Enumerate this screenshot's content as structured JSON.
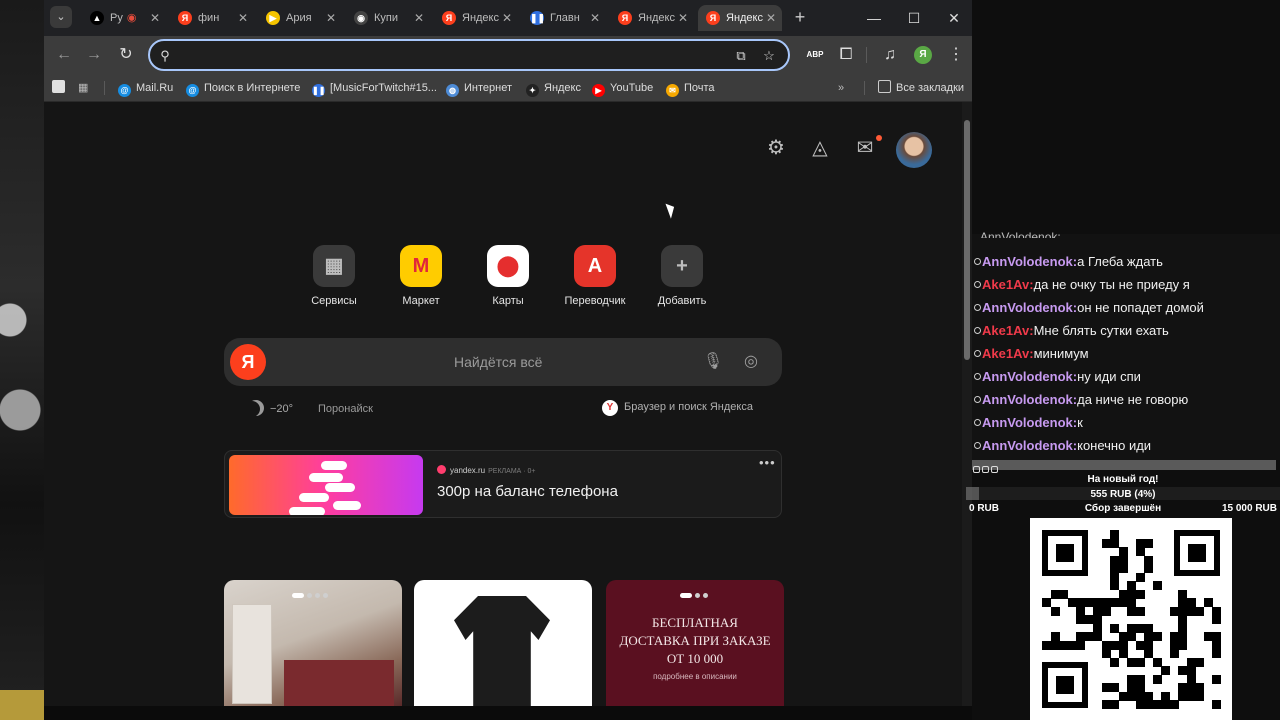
{
  "tabs": [
    {
      "label": "Ру",
      "icon": "twitch-icon",
      "fav_color": "#000000",
      "fav_char": "▲",
      "recording": true
    },
    {
      "label": "фин",
      "icon": "yandex-icon",
      "fav_color": "#fc3f1d",
      "fav_char": "Я"
    },
    {
      "label": "Ария",
      "icon": "play-icon",
      "fav_color": "#f5c400",
      "fav_char": "▶"
    },
    {
      "label": "Купи",
      "icon": "shop-icon",
      "fav_color": "#444444",
      "fav_char": "◉"
    },
    {
      "label": "Яндекс",
      "icon": "yandex-icon",
      "fav_color": "#fc3f1d",
      "fav_char": "Я"
    },
    {
      "label": "Главн",
      "icon": "pause-icon",
      "fav_color": "#2f6fe0",
      "fav_char": "❚❚"
    },
    {
      "label": "Яндекс",
      "icon": "yandex-icon",
      "fav_color": "#fc3f1d",
      "fav_char": "Я"
    },
    {
      "label": "Яндекс",
      "icon": "yandex-icon",
      "fav_color": "#fc3f1d",
      "fav_char": "Я",
      "active": true
    }
  ],
  "address_bar": {
    "value": "",
    "placeholder": ""
  },
  "extensions": [
    {
      "label": "ABP",
      "color": "#e4342f"
    },
    {
      "label": "",
      "color": "#3c3c3c"
    }
  ],
  "profile_initial": "Я",
  "bookmarks": {
    "items": [
      {
        "label": "Mail.Ru",
        "icon": "at-icon",
        "color": "#168de2",
        "char": "@"
      },
      {
        "label": "Поиск в Интернете",
        "icon": "at-icon",
        "color": "#168de2",
        "char": "@"
      },
      {
        "label": "[MusicForTwitch#15...",
        "icon": "pause-icon",
        "color": "#2f6fe0",
        "char": "❚❚"
      },
      {
        "label": "Интернет",
        "icon": "globe-icon",
        "color": "#4d8bd6",
        "char": "◍"
      },
      {
        "label": "Яндекс",
        "icon": "star-icon",
        "color": "#222222",
        "char": "✦"
      },
      {
        "label": "YouTube",
        "icon": "youtube-icon",
        "color": "#ff0000",
        "char": "▶"
      },
      {
        "label": "Почта",
        "icon": "mail-icon",
        "color": "#f6a800",
        "char": "✉"
      }
    ],
    "all_label": "Все закладки"
  },
  "services": [
    {
      "label": "Сервисы",
      "icon": "grid-icon",
      "char": "▦",
      "bg": "#3a3a3a",
      "fg": "#bdbdbd"
    },
    {
      "label": "Маркет",
      "icon": "market-icon",
      "char": "М",
      "bg": "#ffcc00",
      "fg": "#e1263a"
    },
    {
      "label": "Карты",
      "icon": "map-pin-icon",
      "char": "⬤",
      "bg": "#ffffff",
      "fg": "#e52e2e"
    },
    {
      "label": "Переводчик",
      "icon": "translate-icon",
      "char": "A",
      "bg": "#e5342a",
      "fg": "#ffffff"
    },
    {
      "label": "Добавить",
      "icon": "plus-icon",
      "char": "+",
      "bg": "#3a3a3a",
      "fg": "#bdbdbd"
    }
  ],
  "search": {
    "placeholder": "Найдётся всё",
    "logo": "Я"
  },
  "weather": {
    "temp": "−20°"
  },
  "poronaisk": "Поронайск",
  "browser_promo": {
    "label": "Браузер и поиск Яндекса",
    "logo": "Y"
  },
  "ad": {
    "source": "yandex.ru",
    "tag": "РЕКЛАМА · 0+",
    "title": "300р на баланс телефона",
    "more": "•••"
  },
  "cards": [
    {
      "name": "interior"
    },
    {
      "name": "shirt"
    },
    {
      "name": "delivery",
      "lines": [
        "БЕСПЛАТНАЯ",
        "ДОСТАВКА ПРИ ЗАКАЗЕ",
        "ОТ 10 000"
      ],
      "sub": "подробнее в описании"
    }
  ],
  "chat": {
    "messages": [
      {
        "user": "AnnVolodenok",
        "type": "ann",
        "text": "а Глеба ждать"
      },
      {
        "user": "Ake1Av",
        "type": "ake",
        "text": "да не очку ты не приеду я"
      },
      {
        "user": "AnnVolodenok",
        "type": "ann",
        "text": "он не попадет домой"
      },
      {
        "user": "Ake1Av",
        "type": "ake",
        "text": "Мне блять сутки ехать"
      },
      {
        "user": "Ake1Av",
        "type": "ake",
        "text": "минимум"
      },
      {
        "user": "AnnVolodenok",
        "type": "ann",
        "text": "ну иди спи"
      },
      {
        "user": "AnnVolodenok",
        "type": "ann",
        "text": "да ниче не говорю"
      },
      {
        "user": "AnnVolodenok",
        "type": "ann",
        "text": "к"
      },
      {
        "user": "AnnVolodenok",
        "type": "ann",
        "text": "конечно иди"
      }
    ]
  },
  "goal": {
    "title": "На новый год!",
    "amount": "555 RUB (4%)",
    "progress": 0.04,
    "min": "0 RUB",
    "status": "Сбор завершён",
    "max": "15 000 RUB"
  }
}
